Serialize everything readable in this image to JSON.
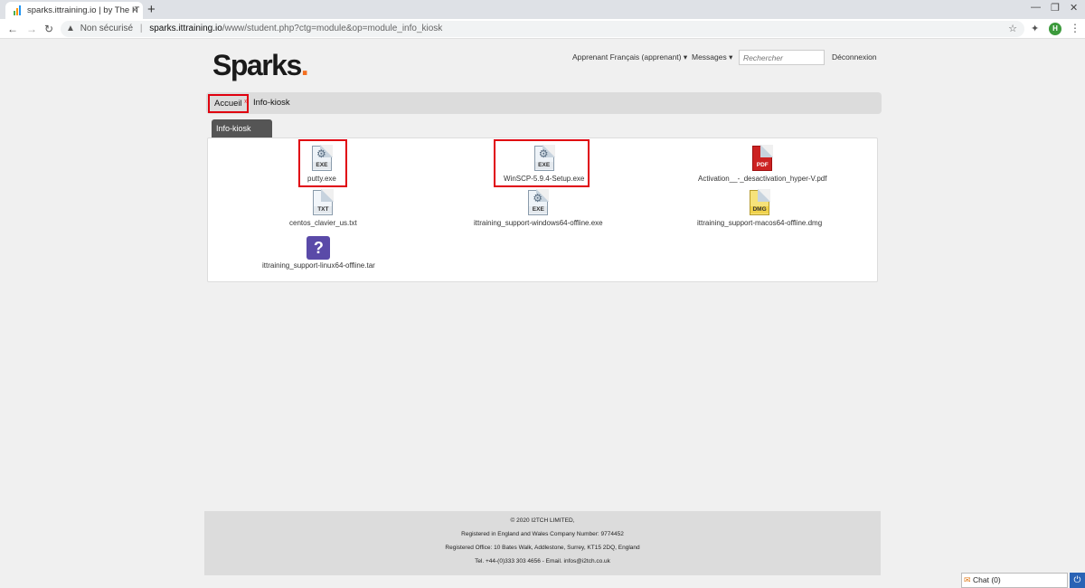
{
  "browser": {
    "tab_title": "sparks.ittraining.io | by The IT",
    "tab_close": "×",
    "new_tab": "+",
    "warning_icon": "▲",
    "not_secure": "Non sécurisé",
    "url_domain": "sparks.ittraining.io",
    "url_path": "/www/student.php?ctg=module&op=module_info_kiosk",
    "avatar_letter": "H"
  },
  "header": {
    "logo_text": "Sparks",
    "logo_dot": ".",
    "user_menu": "Apprenant Français (apprenant) ▾",
    "messages_menu": "Messages ▾",
    "search_placeholder": "Rechercher",
    "logout": "Déconnexion"
  },
  "breadcrumb": {
    "home": "Accueil",
    "separator": "»",
    "current": "Info-kiosk"
  },
  "tab_label": "Info-kiosk",
  "files": [
    {
      "name": "putty.exe",
      "type": "EXE"
    },
    {
      "name": "WinSCP-5.9.4-Setup.exe",
      "type": "EXE"
    },
    {
      "name": "Activation__-_desactivation_hyper-V.pdf",
      "type": "PDF"
    },
    {
      "name": "centos_clavier_us.txt",
      "type": "TXT"
    },
    {
      "name": "ittraining_support-windows64-offline.exe",
      "type": "EXE"
    },
    {
      "name": "ittraining_support-macos64-offline.dmg",
      "type": "DMG"
    },
    {
      "name": "ittraining_support-linux64-offline.tar",
      "type": "?"
    }
  ],
  "footer": {
    "line1": "© 2020 I2TCH LIMITED,",
    "line2": "Registered in England and Wales Company Number: 9774452",
    "line3": "Registered Office: 10 Bates Walk, Addlestone, Surrey, KT15 2DQ, England",
    "line4": "Tel. +44-(0)333 303 4656 - Email. infos@i2tch.co.uk"
  },
  "chat": {
    "label": "Chat (0)"
  },
  "colors": {
    "brand_dot": "#f36f21",
    "highlight": "#e0000f"
  }
}
